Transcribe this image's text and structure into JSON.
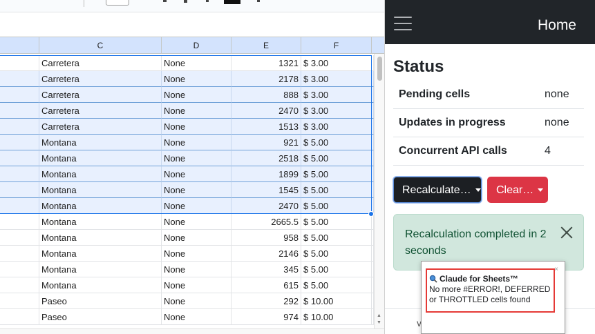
{
  "sheet": {
    "columns": [
      "C",
      "D",
      "E",
      "F"
    ],
    "rows": [
      {
        "c": "Carretera",
        "d": "None",
        "e": "1321",
        "f": "$ 3.00",
        "selected": false
      },
      {
        "c": "Carretera",
        "d": "None",
        "e": "2178",
        "f": "$ 3.00",
        "selected": true
      },
      {
        "c": "Carretera",
        "d": "None",
        "e": "888",
        "f": "$ 3.00",
        "selected": true
      },
      {
        "c": "Carretera",
        "d": "None",
        "e": "2470",
        "f": "$ 3.00",
        "selected": true
      },
      {
        "c": "Carretera",
        "d": "None",
        "e": "1513",
        "f": "$ 3.00",
        "selected": true
      },
      {
        "c": "Montana",
        "d": "None",
        "e": "921",
        "f": "$ 5.00",
        "selected": true
      },
      {
        "c": "Montana",
        "d": "None",
        "e": "2518",
        "f": "$ 5.00",
        "selected": true
      },
      {
        "c": "Montana",
        "d": "None",
        "e": "1899",
        "f": "$ 5.00",
        "selected": true
      },
      {
        "c": "Montana",
        "d": "None",
        "e": "1545",
        "f": "$ 5.00",
        "selected": true
      },
      {
        "c": "Montana",
        "d": "None",
        "e": "2470",
        "f": "$ 5.00",
        "selected": true
      },
      {
        "c": "Montana",
        "d": "None",
        "e": "2665.5",
        "f": "$ 5.00",
        "selected": false
      },
      {
        "c": "Montana",
        "d": "None",
        "e": "958",
        "f": "$ 5.00",
        "selected": false
      },
      {
        "c": "Montana",
        "d": "None",
        "e": "2146",
        "f": "$ 5.00",
        "selected": false
      },
      {
        "c": "Montana",
        "d": "None",
        "e": "345",
        "f": "$ 5.00",
        "selected": false
      },
      {
        "c": "Montana",
        "d": "None",
        "e": "615",
        "f": "$ 5.00",
        "selected": false
      },
      {
        "c": "Paseo",
        "d": "None",
        "e": "292",
        "f": "$ 10.00",
        "selected": false
      },
      {
        "c": "Paseo",
        "d": "None",
        "e": "974",
        "f": "$ 10.00",
        "selected": false
      }
    ],
    "colors": {
      "header_bg": "#d3e3fd",
      "selection": "#1a73e8",
      "selected_row_bg": "#e8f0fe"
    }
  },
  "sidebar": {
    "nav_title": "Home",
    "status_heading": "Status",
    "status_rows": [
      {
        "label": "Pending cells",
        "value": "none"
      },
      {
        "label": "Updates in progress",
        "value": "none"
      },
      {
        "label": "Concurrent API calls",
        "value": "4"
      }
    ],
    "recalc_button": "Recalculate…",
    "clear_button": "Clear…",
    "alert_message": "Recalculation completed in 2 seconds",
    "footer_peek": "v",
    "colors": {
      "navbar": "#212529",
      "danger": "#dc3545",
      "success_bg": "#d1e7dd",
      "success_text": "#0f5132"
    }
  },
  "popup": {
    "title": "Claude for Sheets™",
    "body": "No more #ERROR!, DEFERRED or THROTTLED cells found",
    "close": "×",
    "icon": "magnifier-icon"
  }
}
